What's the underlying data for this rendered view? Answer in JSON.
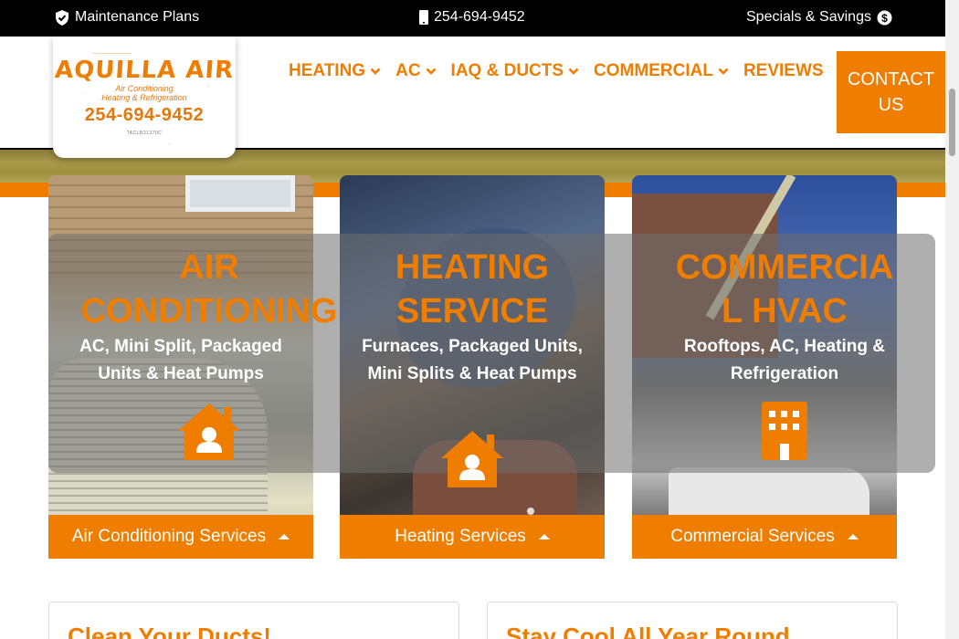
{
  "topbar": {
    "maintenance_label": "Maintenance Plans",
    "phone_label": "254-694-9452",
    "specials_label": "Specials & Savings"
  },
  "logo": {
    "brand": "AQUILLA AIR",
    "line1": "Air Conditioning",
    "line2": "Heating & Refrigeration",
    "phone": "254-694-9452",
    "license": "TACLB31370C"
  },
  "nav": {
    "items": [
      {
        "label": "HEATING",
        "has_dropdown": true
      },
      {
        "label": "AC",
        "has_dropdown": true
      },
      {
        "label": "IAQ & DUCTS",
        "has_dropdown": true
      },
      {
        "label": "COMMERCIAL",
        "has_dropdown": true
      },
      {
        "label": "REVIEWS",
        "has_dropdown": false
      }
    ],
    "contact_line1": "CONTACT",
    "contact_line2": "US"
  },
  "cards": [
    {
      "title_line1": "AIR",
      "title_line2": "CONDITIONING",
      "desc": "AC, Mini Split, Packaged Units & Heat Pumps",
      "icon": "house-user-icon",
      "button": "Air Conditioning Services"
    },
    {
      "title_line1": "HEATING",
      "title_line2": "SERVICE",
      "desc": "Furnaces, Packaged Units, Mini Splits & Heat Pumps",
      "icon": "house-user-icon",
      "button": "Heating Services"
    },
    {
      "title_line1": "COMMERCIA",
      "title_line2": "L HVAC",
      "desc": "Rooftops, AC, Heating & Refrigeration",
      "icon": "building-icon",
      "button": "Commercial Services"
    }
  ],
  "info_cards": [
    {
      "title": "Clean Your Ducts!"
    },
    {
      "title": "Stay Cool All Year Round"
    }
  ],
  "colors": {
    "accent": "#ee7d00",
    "topbar_bg": "#000000",
    "overlay": "#6e6e6e"
  }
}
